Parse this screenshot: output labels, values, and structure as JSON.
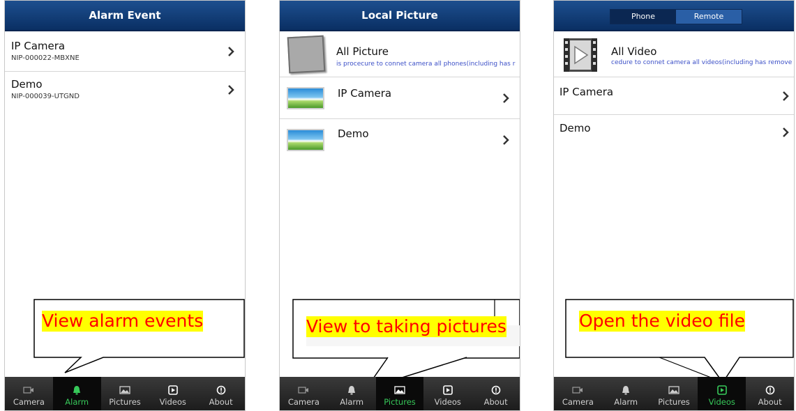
{
  "screen1": {
    "title": "Alarm Event",
    "items": [
      {
        "title": "IP Camera",
        "subtitle": "NIP-000022-MBXNE"
      },
      {
        "title": "Demo",
        "subtitle": "NIP-000039-UTGND"
      }
    ],
    "callout": "View alarm events"
  },
  "screen2": {
    "title": "Local Picture",
    "all_title": "All Picture",
    "all_subtitle": "is procecure to connet camera all phones(including has r",
    "items": [
      {
        "title": "IP Camera"
      },
      {
        "title": "Demo"
      }
    ],
    "callout": "View to taking pictures"
  },
  "screen3": {
    "segment": {
      "left": "Phone",
      "right": "Remote"
    },
    "all_title": "All Video",
    "all_subtitle": "cedure to connet camera all videos(including has remove",
    "items": [
      {
        "title": "IP Camera"
      },
      {
        "title": "Demo"
      }
    ],
    "callout": "Open the video file"
  },
  "tabs": [
    "Camera",
    "Alarm",
    "Pictures",
    "Videos",
    "About"
  ],
  "colors": {
    "header": "#0a2f63",
    "tab_active_text": "#37c95a",
    "callout_text": "#ff0000",
    "callout_bg": "#ffff00"
  }
}
